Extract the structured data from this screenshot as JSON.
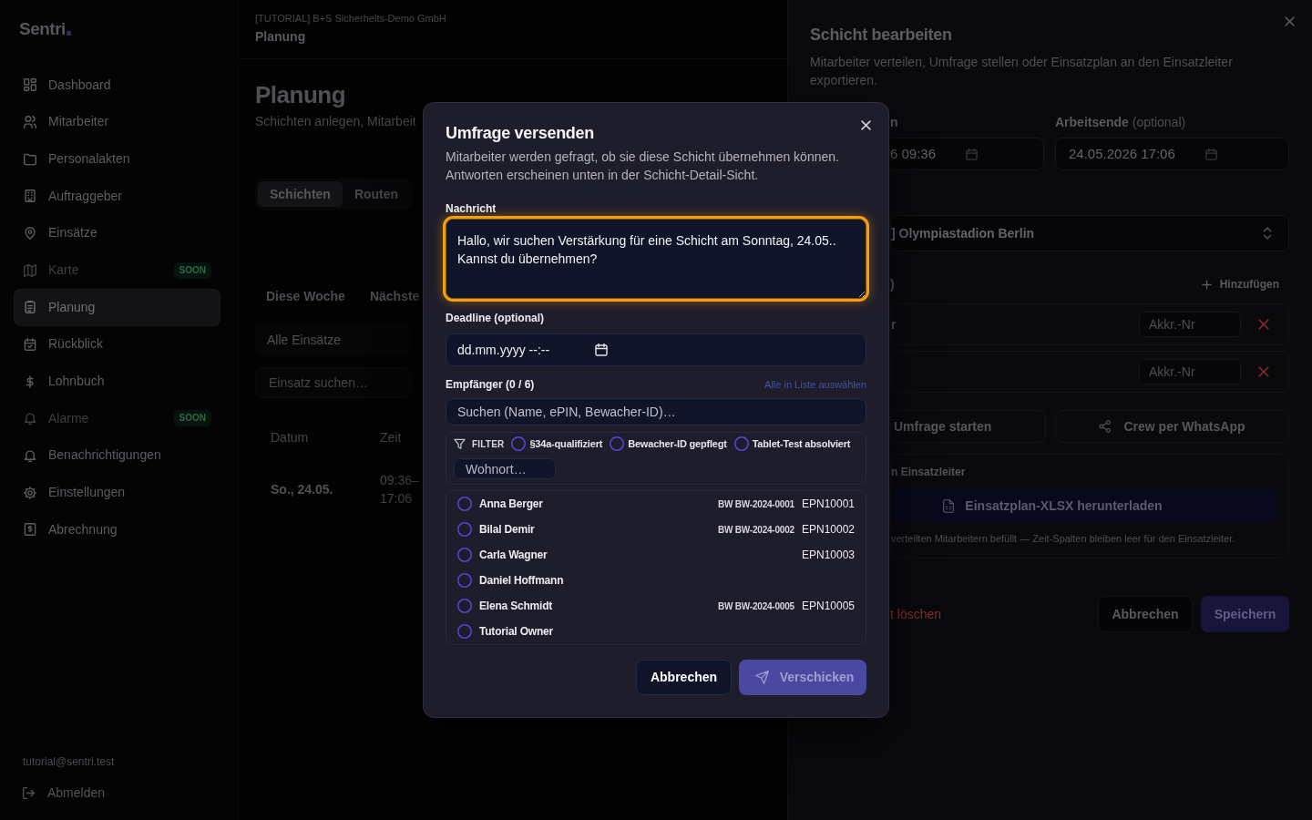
{
  "sidebar": {
    "logo": "Sentri",
    "items": [
      {
        "label": "Dashboard",
        "selected": false,
        "disabled": false
      },
      {
        "label": "Mitarbeiter",
        "selected": false,
        "disabled": false
      },
      {
        "label": "Personalakten",
        "selected": false,
        "disabled": false
      },
      {
        "label": "Auftraggeber",
        "selected": false,
        "disabled": false
      },
      {
        "label": "Einsätze",
        "selected": false,
        "disabled": false
      },
      {
        "label": "Karte",
        "selected": false,
        "disabled": true,
        "badge": "SOON"
      },
      {
        "label": "Planung",
        "selected": true,
        "disabled": false
      },
      {
        "label": "Rückblick",
        "selected": false,
        "disabled": false
      },
      {
        "label": "Lohnbuch",
        "selected": false,
        "disabled": false
      },
      {
        "label": "Alarme",
        "selected": false,
        "disabled": true,
        "badge": "SOON"
      },
      {
        "label": "Benachrichtigungen",
        "selected": false,
        "disabled": false
      },
      {
        "label": "Einstellungen",
        "selected": false,
        "disabled": false
      },
      {
        "label": "Abrechnung",
        "selected": false,
        "disabled": false
      }
    ],
    "user_email": "tutorial@sentri.test",
    "logout": "Abmelden"
  },
  "header": {
    "organization": "[TUTORIAL] B+S Sicherheits-Demo GmbH",
    "section": "Planung"
  },
  "page": {
    "title": "Planung",
    "subtitle": "Schichten anlegen, Mitarbeit",
    "tabs": [
      {
        "label": "Schichten",
        "selected": true
      },
      {
        "label": "Routen",
        "selected": false
      }
    ],
    "period_filters": [
      {
        "label": "Diese Woche"
      },
      {
        "label": "Nächste"
      }
    ],
    "site_select": {
      "value": "Alle Einsätze"
    },
    "search": {
      "placeholder": "Einsatz suchen…"
    },
    "table": {
      "columns": [
        "Datum",
        "Zeit"
      ],
      "rows": [
        [
          "So., 24.05.",
          "09:36–17:06"
        ]
      ]
    }
  },
  "drawer": {
    "title": "Schicht bearbeiten",
    "description": "Mitarbeiter verteilen, Umfrage stellen oder Einsatzplan an den Einsatzleiter exportieren.",
    "start": {
      "label": "n",
      "value": "6 09:36"
    },
    "end": {
      "label": "Arbeitsende",
      "hint": "(optional)",
      "value": "24.05.2026 17:06"
    },
    "site": {
      "value": "] Olympiastadion Berlin"
    },
    "crew": {
      "label": ")",
      "add": "Hinzufügen",
      "rows": [
        {
          "label": "r",
          "placeholder": "Akkr.-Nr"
        },
        {
          "placeholder": "Akkr.-Nr"
        }
      ]
    },
    "actions": [
      {
        "label": "Umfrage starten"
      },
      {
        "label": "Crew per WhatsApp"
      }
    ],
    "export": {
      "title": "n Einsatzleiter",
      "button": "Einsatzplan-XLSX herunterladen",
      "note": "verteilten Mitarbeitern befüllt — Zeit-Spalten bleiben leer für den Einsatzleiter."
    },
    "delete": "t löschen",
    "cancel": "Abbrechen",
    "save": "Speichern"
  },
  "dialog": {
    "title": "Umfrage versenden",
    "description": "Mitarbeiter werden gefragt, ob sie diese Schicht übernehmen können. Antworten erscheinen unten in der Schicht-Detail-Sicht.",
    "message": {
      "label": "Nachricht",
      "value": "Hallo, wir suchen Verstärkung für eine Schicht am Sonntag, 24.05..\nKannst du übernehmen?",
      "focused": true
    },
    "deadline": {
      "label": "Deadline (optional)",
      "placeholder": "dd.mm.yyyy --:--"
    },
    "recipients": {
      "label": "Empfänger (0 / 6)",
      "select_all": {
        "label": "Alle in Liste auswählen",
        "disabled": true
      },
      "search_placeholder": "Suchen (Name, ePIN, Bewacher-ID)…",
      "filter_label": "FILTER",
      "filters": [
        {
          "label": "§34a-qualifiziert",
          "checked": false
        },
        {
          "label": "Bewacher-ID gepflegt",
          "checked": false
        },
        {
          "label": "Tablet-Test absolviert",
          "checked": false
        }
      ],
      "city_placeholder": "Wohnort…",
      "people": [
        {
          "name": "Anna Berger",
          "bewacher_id": "BW BW-2024-0001",
          "epin": "EPN10001",
          "checked": false
        },
        {
          "name": "Bilal Demir",
          "bewacher_id": "BW BW-2024-0002",
          "epin": "EPN10002",
          "checked": false
        },
        {
          "name": "Carla Wagner",
          "epin": "EPN10003",
          "checked": false
        },
        {
          "name": "Daniel Hoffmann",
          "checked": false
        },
        {
          "name": "Elena Schmidt",
          "bewacher_id": "BW BW-2024-0005",
          "epin": "EPN10005",
          "checked": false
        },
        {
          "name": "Tutorial Owner",
          "checked": false
        }
      ]
    },
    "cancel": "Abbrechen",
    "send": {
      "label": "Verschicken",
      "disabled": true
    }
  }
}
